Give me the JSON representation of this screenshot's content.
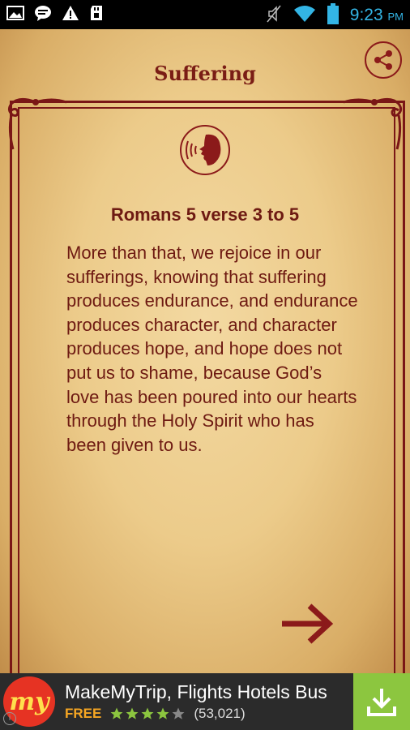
{
  "status_bar": {
    "time": "9:23",
    "ampm": "PM",
    "left_icons": [
      "image-icon",
      "chat-icon",
      "warning-icon",
      "sd-card-icon"
    ],
    "right_icons": [
      "mute-icon",
      "wifi-icon",
      "battery-icon"
    ]
  },
  "page": {
    "title": "Suffering",
    "verse_reference": "Romans 5 verse 3 to 5",
    "verse_text": "More than that, we rejoice in our sufferings, knowing that suffering produces endurance, and endurance produces character, and character produces hope, and hope does not put us to shame, because God’s love has been poured into our hearts through the Holy Spirit who has been given to us."
  },
  "ad": {
    "logo_text": "my",
    "title": "MakeMyTrip, Flights Hotels Bus",
    "price": "FREE",
    "rating": 4,
    "rating_max": 5,
    "reviews": "(53,021)"
  },
  "colors": {
    "accent": "#7a1d15",
    "ad_download": "#8cc63f",
    "time": "#33b5e5"
  }
}
